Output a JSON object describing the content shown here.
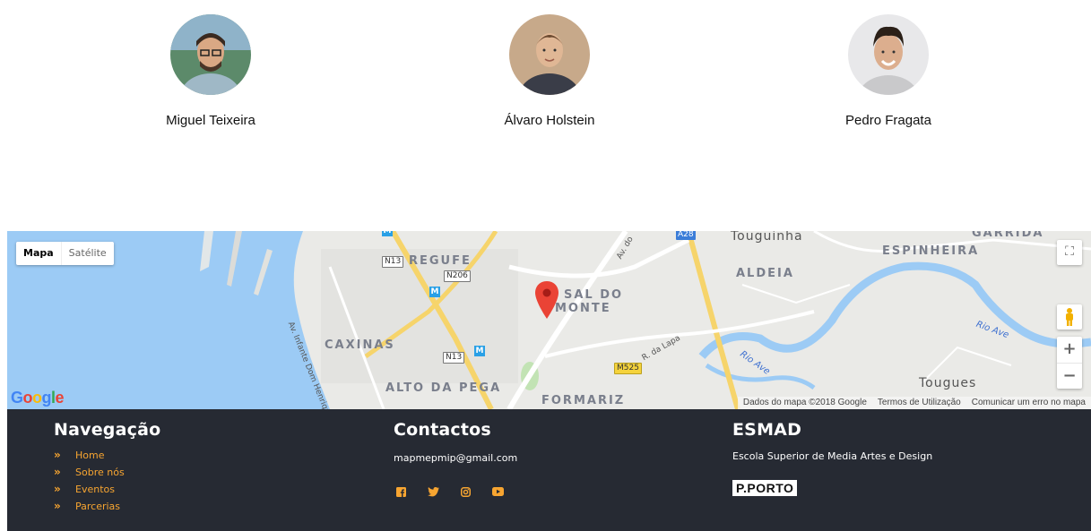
{
  "team": {
    "members": [
      {
        "name": "Miguel Teixeira"
      },
      {
        "name": "Álvaro Holstein"
      },
      {
        "name": "Pedro Fragata"
      }
    ]
  },
  "map": {
    "type_control": {
      "map_label": "Mapa",
      "satellite_label": "Satélite"
    },
    "logo_text": "Google",
    "footer": {
      "data_label": "Dados do mapa ©2018 Google",
      "terms_label": "Termos de Utilização",
      "report_label": "Comunicar um erro no mapa"
    },
    "zoom_in_label": "+",
    "zoom_out_label": "−",
    "places": {
      "regufe": "REGUFE",
      "sal_do_monte_1": "SAL DO",
      "sal_do_monte_2": "MONTE",
      "caxinas": "CAXINAS",
      "alto_da_pega": "ALTO DA PEGA",
      "formariz": "FORMARIZ",
      "aldeia": "ALDEIA",
      "espinheira": "ESPINHEIRA",
      "garrida": "GARRIDA",
      "touguinha": "Touguinha",
      "tougues": "Tougues"
    },
    "roads": {
      "n13_top": "N13",
      "n206": "N206",
      "n13_mid": "N13",
      "m525": "M525",
      "a28": "A28"
    },
    "streets": {
      "infante": "Av. Infante Dom Henrique",
      "lapa": "R. da Lapa",
      "av_do": "Av. do"
    },
    "rivers": {
      "ave1": "Rio Ave",
      "ave2": "Rio Ave"
    },
    "colors": {
      "water": "#9ccbf5",
      "land": "#eaeae7",
      "park": "#c2e3b4",
      "highway": "#f6d46b",
      "pin": "#ea4335"
    }
  },
  "footer": {
    "navigation": {
      "title": "Navegação",
      "items": [
        {
          "label": "Home"
        },
        {
          "label": "Sobre nós"
        },
        {
          "label": "Eventos"
        },
        {
          "label": "Parcerias"
        }
      ]
    },
    "contacts": {
      "title": "Contactos",
      "email": "mapmepmip@gmail.com",
      "socials": [
        "facebook-icon",
        "twitter-icon",
        "instagram-icon",
        "youtube-icon"
      ]
    },
    "esmad": {
      "title": "ESMAD",
      "subtitle": "Escola Superior de Media Artes e Design",
      "logo_text": "P.PORTO"
    },
    "colors": {
      "background": "#262a33",
      "accent": "#f7a531"
    }
  }
}
